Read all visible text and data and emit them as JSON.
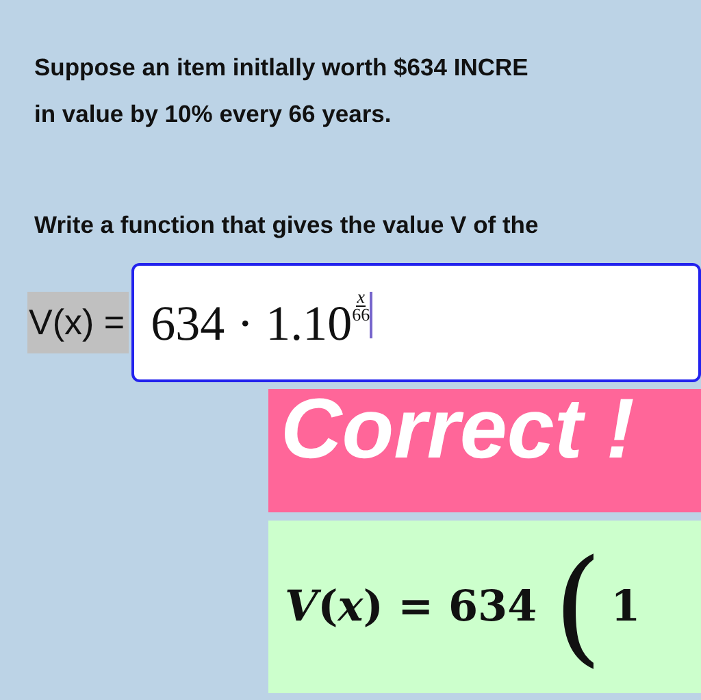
{
  "problem": {
    "lines": [
      "Suppose an item initlally worth $634 INCRE",
      "in value by 10% every 66 years."
    ]
  },
  "instruction": "Write a function that gives the value V of the",
  "answer": {
    "label": "V(x) =",
    "base": "634 · 1.10",
    "exponent_numerator": "x",
    "exponent_denominator": "66",
    "focused": true
  },
  "feedback": {
    "message": "Correct !",
    "solution": {
      "lhs": "*V*(*x*) = 634",
      "paren": "(",
      "term": "1"
    }
  }
}
